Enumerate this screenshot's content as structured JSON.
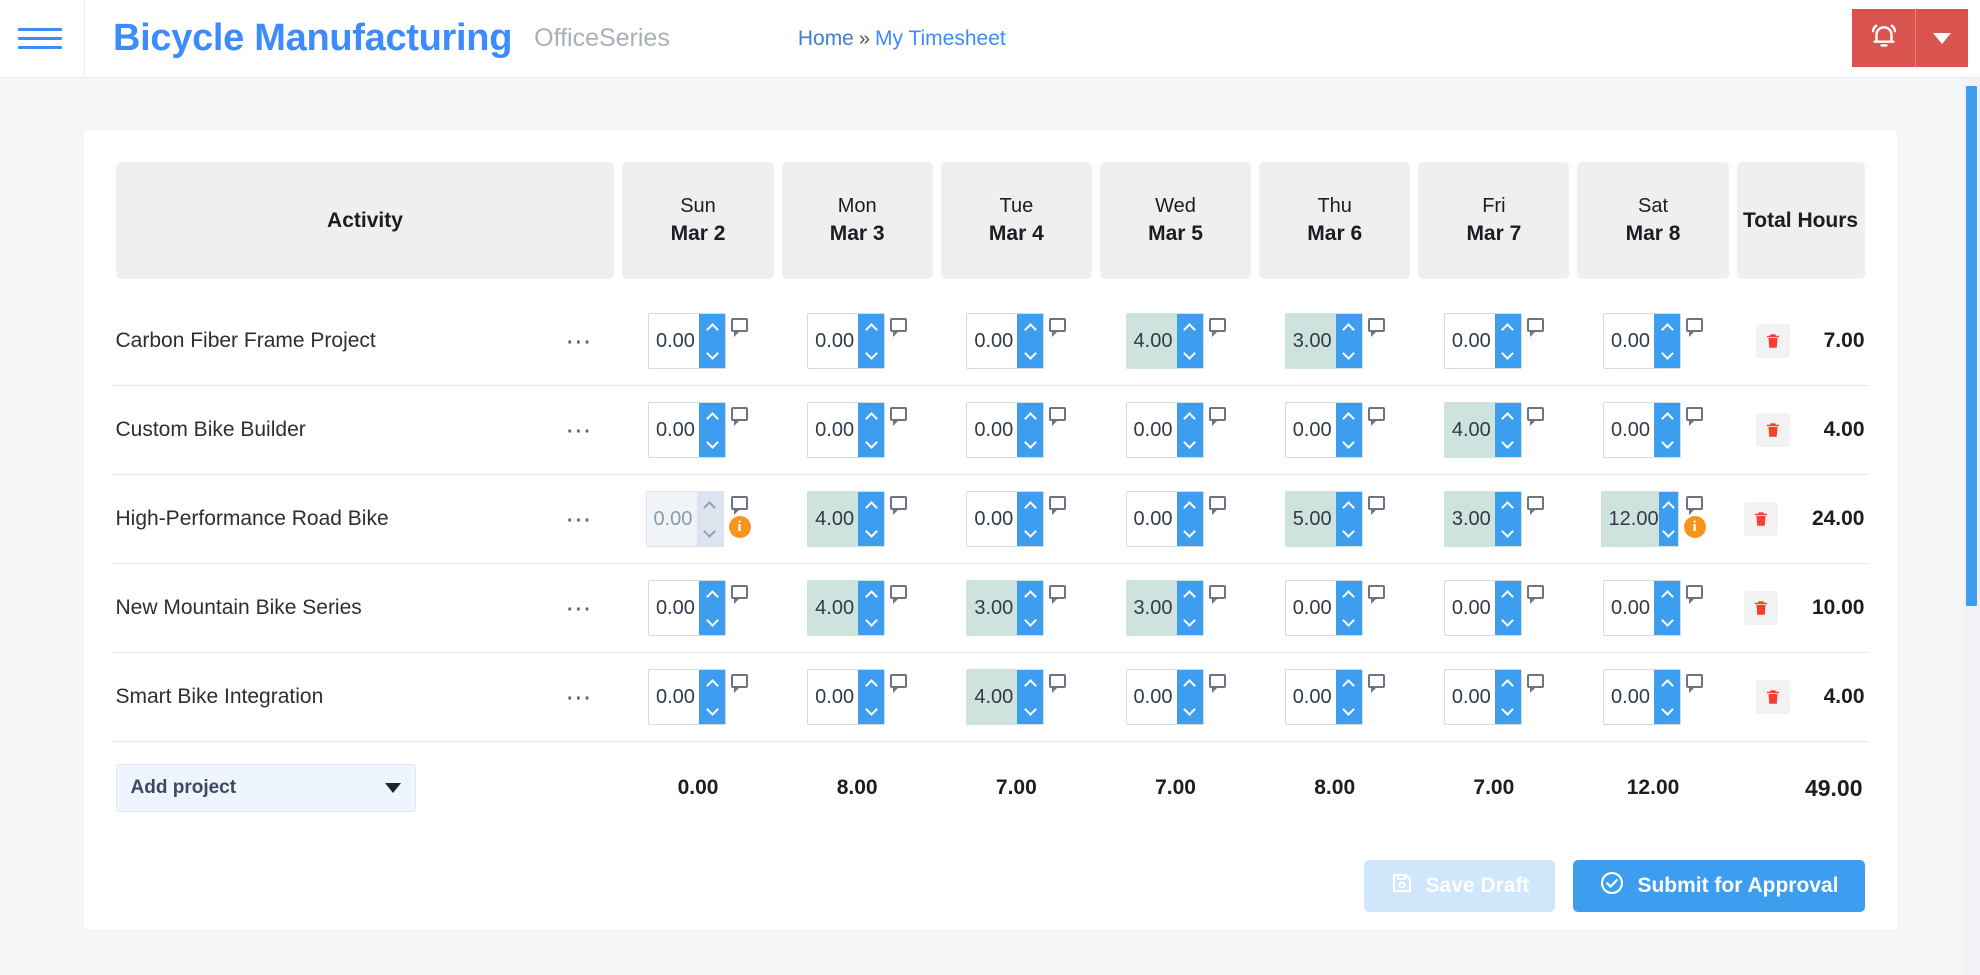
{
  "header": {
    "menu_icon": "hamburger-icon",
    "brand": "Bicycle Manufacturing",
    "brand_suffix": "OfficeSeries",
    "breadcrumb": {
      "home": "Home",
      "separator": "»",
      "current": "My Timesheet"
    },
    "bell_icon": "alarm-bell-icon",
    "caret_icon": "chevron-down-icon",
    "accent_color": "#3d8bfd",
    "alert_color": "#d9534f"
  },
  "table": {
    "columns": [
      {
        "label": "Activity"
      },
      {
        "dayname": "Sun",
        "daydate": "Mar 2"
      },
      {
        "dayname": "Mon",
        "daydate": "Mar 3"
      },
      {
        "dayname": "Tue",
        "daydate": "Mar 4"
      },
      {
        "dayname": "Wed",
        "daydate": "Mar 5"
      },
      {
        "dayname": "Thu",
        "daydate": "Mar 6"
      },
      {
        "dayname": "Fri",
        "daydate": "Mar 7"
      },
      {
        "dayname": "Sat",
        "daydate": "Mar 8"
      },
      {
        "label": "Total Hours"
      }
    ],
    "rows": [
      {
        "activity": "Carbon Fiber Frame Project",
        "menu_icon": "ellipsis-icon",
        "cells": [
          {
            "value": "0.00",
            "filled": false,
            "disabled": false,
            "info": false
          },
          {
            "value": "0.00",
            "filled": false,
            "disabled": false,
            "info": false
          },
          {
            "value": "0.00",
            "filled": false,
            "disabled": false,
            "info": false
          },
          {
            "value": "4.00",
            "filled": true,
            "disabled": false,
            "info": false
          },
          {
            "value": "3.00",
            "filled": true,
            "disabled": false,
            "info": false
          },
          {
            "value": "0.00",
            "filled": false,
            "disabled": false,
            "info": false
          },
          {
            "value": "0.00",
            "filled": false,
            "disabled": false,
            "info": false
          }
        ],
        "total": "7.00",
        "delete_icon": "trash-icon"
      },
      {
        "activity": "Custom Bike Builder",
        "menu_icon": "ellipsis-icon",
        "cells": [
          {
            "value": "0.00",
            "filled": false,
            "disabled": false,
            "info": false
          },
          {
            "value": "0.00",
            "filled": false,
            "disabled": false,
            "info": false
          },
          {
            "value": "0.00",
            "filled": false,
            "disabled": false,
            "info": false
          },
          {
            "value": "0.00",
            "filled": false,
            "disabled": false,
            "info": false
          },
          {
            "value": "0.00",
            "filled": false,
            "disabled": false,
            "info": false
          },
          {
            "value": "4.00",
            "filled": true,
            "disabled": false,
            "info": false
          },
          {
            "value": "0.00",
            "filled": false,
            "disabled": false,
            "info": false
          }
        ],
        "total": "4.00",
        "delete_icon": "trash-icon"
      },
      {
        "activity": "High-Performance Road Bike",
        "menu_icon": "ellipsis-icon",
        "cells": [
          {
            "value": "0.00",
            "filled": false,
            "disabled": true,
            "info": true
          },
          {
            "value": "4.00",
            "filled": true,
            "disabled": false,
            "info": false
          },
          {
            "value": "0.00",
            "filled": false,
            "disabled": false,
            "info": false
          },
          {
            "value": "0.00",
            "filled": false,
            "disabled": false,
            "info": false
          },
          {
            "value": "5.00",
            "filled": true,
            "disabled": false,
            "info": false
          },
          {
            "value": "3.00",
            "filled": true,
            "disabled": false,
            "info": false
          },
          {
            "value": "12.00",
            "filled": true,
            "disabled": false,
            "info": true
          }
        ],
        "total": "24.00",
        "delete_icon": "trash-icon"
      },
      {
        "activity": "New Mountain Bike Series",
        "menu_icon": "ellipsis-icon",
        "cells": [
          {
            "value": "0.00",
            "filled": false,
            "disabled": false,
            "info": false
          },
          {
            "value": "4.00",
            "filled": true,
            "disabled": false,
            "info": false
          },
          {
            "value": "3.00",
            "filled": true,
            "disabled": false,
            "info": false
          },
          {
            "value": "3.00",
            "filled": true,
            "disabled": false,
            "info": false
          },
          {
            "value": "0.00",
            "filled": false,
            "disabled": false,
            "info": false
          },
          {
            "value": "0.00",
            "filled": false,
            "disabled": false,
            "info": false
          },
          {
            "value": "0.00",
            "filled": false,
            "disabled": false,
            "info": false
          }
        ],
        "total": "10.00",
        "delete_icon": "trash-icon"
      },
      {
        "activity": "Smart Bike Integration",
        "menu_icon": "ellipsis-icon",
        "cells": [
          {
            "value": "0.00",
            "filled": false,
            "disabled": false,
            "info": false
          },
          {
            "value": "0.00",
            "filled": false,
            "disabled": false,
            "info": false
          },
          {
            "value": "4.00",
            "filled": true,
            "disabled": false,
            "info": false
          },
          {
            "value": "0.00",
            "filled": false,
            "disabled": false,
            "info": false
          },
          {
            "value": "0.00",
            "filled": false,
            "disabled": false,
            "info": false
          },
          {
            "value": "0.00",
            "filled": false,
            "disabled": false,
            "info": false
          },
          {
            "value": "0.00",
            "filled": false,
            "disabled": false,
            "info": false
          }
        ],
        "total": "4.00",
        "delete_icon": "trash-icon"
      }
    ],
    "footer": {
      "add_project_label": "Add project",
      "add_project_caret": "chevron-down-icon",
      "day_totals": [
        "0.00",
        "8.00",
        "7.00",
        "7.00",
        "8.00",
        "7.00",
        "12.00"
      ],
      "grand_total": "49.00"
    }
  },
  "actions": {
    "save_draft": {
      "label": "Save Draft",
      "icon": "save-disk-icon",
      "disabled": true
    },
    "submit": {
      "label": "Submit for Approval",
      "icon": "check-circle-icon"
    }
  },
  "scrollbar": {
    "color": "#3d9ef0"
  }
}
